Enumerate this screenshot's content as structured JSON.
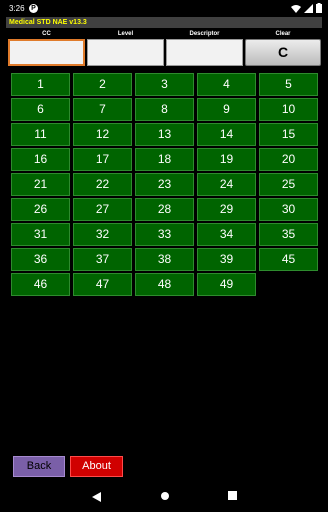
{
  "status_bar": {
    "time": "3:26",
    "app_icon": "P",
    "icons": [
      "wifi-icon",
      "signal-icon",
      "battery-icon"
    ]
  },
  "app": {
    "title": "Medical STD NAE v13.3"
  },
  "fields": {
    "cc_label": "CC",
    "level_label": "Level",
    "descriptor_label": "Descriptor",
    "clear_label": "Clear",
    "cc_value": "",
    "level_value": "",
    "descriptor_value": "",
    "clear_button": "C"
  },
  "grid": {
    "columns": 5,
    "numbers": [
      "1",
      "2",
      "3",
      "4",
      "5",
      "6",
      "7",
      "8",
      "9",
      "10",
      "11",
      "12",
      "13",
      "14",
      "15",
      "16",
      "17",
      "18",
      "19",
      "20",
      "21",
      "22",
      "23",
      "24",
      "25",
      "26",
      "27",
      "28",
      "29",
      "30",
      "31",
      "32",
      "33",
      "34",
      "35",
      "36",
      "37",
      "38",
      "39",
      "45",
      "46",
      "47",
      "48",
      "49"
    ]
  },
  "buttons": {
    "back": "Back",
    "about": "About"
  },
  "nav": {
    "icons": [
      "nav-back-icon",
      "nav-home-icon",
      "nav-recent-icon"
    ]
  },
  "colors": {
    "title_text": "#ffff00",
    "cell_bg": "#006400",
    "back_bg": "#7a5fa8",
    "about_bg": "#d00000",
    "focus_border": "#e07b2b"
  }
}
